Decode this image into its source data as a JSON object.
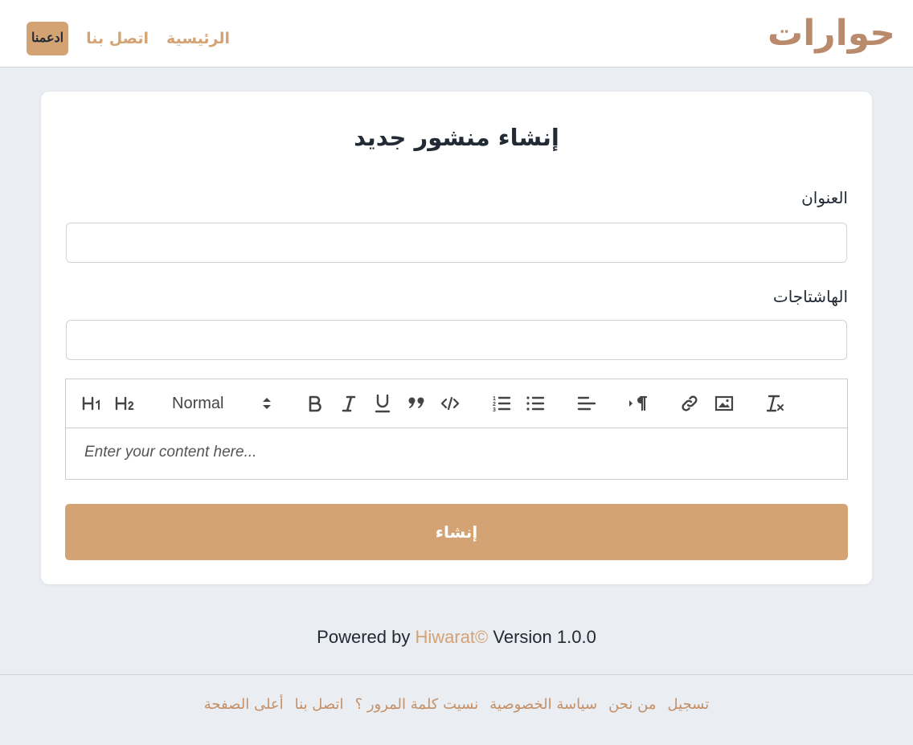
{
  "header": {
    "logo_text": "حوارات",
    "nav": {
      "home": "الرئيسية",
      "contact": "اتصل بنا",
      "support": "ادعمنا"
    }
  },
  "form": {
    "title": "إنشاء منشور جديد",
    "title_label": "العنوان",
    "title_value": "",
    "hashtags_label": "الهاشتاجات",
    "hashtags_value": "",
    "editor": {
      "toolbar": [
        "H1",
        "H2",
        "header-select",
        "bold",
        "italic",
        "underline",
        "blockquote",
        "code",
        "ordered-list",
        "bullet-list",
        "align",
        "direction",
        "link",
        "image",
        "clean"
      ],
      "header_select_value": "Normal",
      "placeholder": "Enter your content here..."
    },
    "submit_label": "إنشاء"
  },
  "footer": {
    "powered_prefix": "Powered by",
    "brand": "Hiwarat©",
    "version": "Version 1.0.0",
    "links": [
      "تسجيل",
      "من نحن",
      "سياسة الخصوصية",
      "نسيت كلمة المرور ؟",
      "اتصل بنا",
      "أعلى الصفحة"
    ]
  },
  "colors": {
    "accent": "#d4a373",
    "logo": "#b98a6b",
    "page_bg": "#eaedf2",
    "text": "#222a35"
  }
}
